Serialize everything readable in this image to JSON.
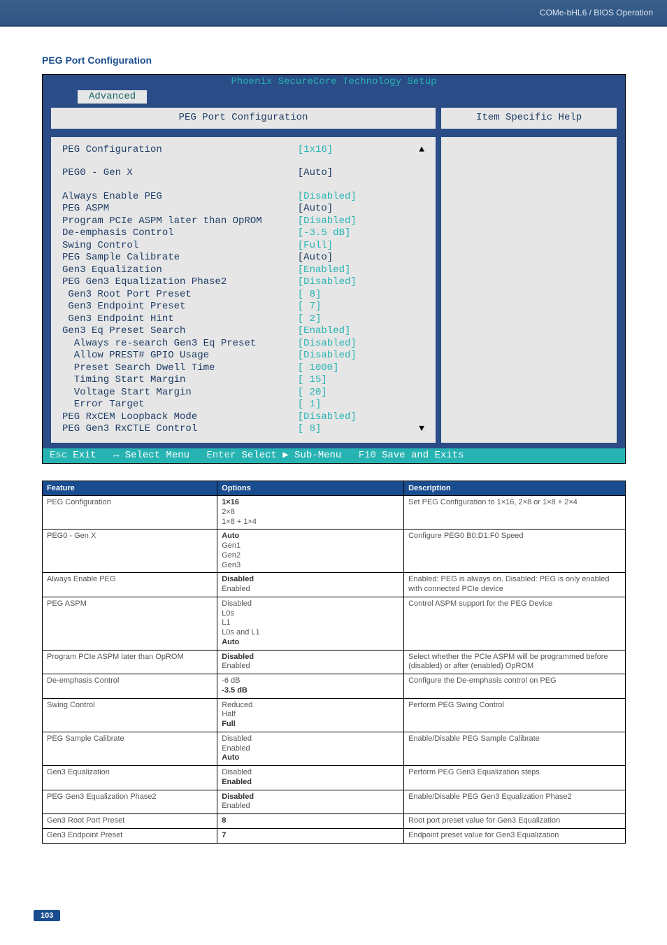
{
  "page_header": {
    "breadcrumb": "COMe-bHL6 / BIOS Operation"
  },
  "section_title": "PEG Port Configuration",
  "bios": {
    "title": "Phoenix SecureCore Technology Setup",
    "tab": "Advanced",
    "panel_heading": "PEG Port Configuration",
    "help_heading": "Item Specific Help",
    "items": [
      {
        "label": "PEG Configuration",
        "value": "[1x16]",
        "type": "edit",
        "blank_after": true,
        "arrow": "up"
      },
      {
        "label": "PEG0 - Gen X",
        "value": "[Auto]",
        "type": "link",
        "blank_after": true
      },
      {
        "label": "Always Enable PEG",
        "value": "[Disabled]",
        "type": "edit"
      },
      {
        "label": "PEG ASPM",
        "value": "[Auto]",
        "type": "link"
      },
      {
        "label": "Program PCIe ASPM later than OpROM",
        "value": "[Disabled]",
        "type": "edit"
      },
      {
        "label": "De-emphasis Control",
        "value": "[-3.5 dB]",
        "type": "edit"
      },
      {
        "label": "Swing Control",
        "value": "[Full]",
        "type": "edit"
      },
      {
        "label": "PEG Sample Calibrate",
        "value": "[Auto]",
        "type": "link"
      },
      {
        "label": "Gen3 Equalization",
        "value": "[Enabled]",
        "type": "edit"
      },
      {
        "label": "PEG Gen3 Equalization Phase2",
        "value": "[Disabled]",
        "type": "edit"
      },
      {
        "label": " Gen3 Root Port Preset",
        "value": "[ 8]",
        "type": "edit"
      },
      {
        "label": " Gen3 Endpoint Preset",
        "value": "[ 7]",
        "type": "edit"
      },
      {
        "label": " Gen3 Endpoint Hint",
        "value": "[ 2]",
        "type": "edit"
      },
      {
        "label": "Gen3 Eq Preset Search",
        "value": "[Enabled]",
        "type": "edit"
      },
      {
        "label": "  Always re-search Gen3 Eq Preset",
        "value": "[Disabled]",
        "type": "edit"
      },
      {
        "label": "  Allow PREST# GPIO Usage",
        "value": "[Disabled]",
        "type": "edit"
      },
      {
        "label": "  Preset Search Dwell Time",
        "value": "[ 1000]",
        "type": "edit"
      },
      {
        "label": "  Timing Start Margin",
        "value": "[ 15]",
        "type": "edit"
      },
      {
        "label": "  Voltage Start Margin",
        "value": "[ 20]",
        "type": "edit"
      },
      {
        "label": "  Error Target",
        "value": "[   1]",
        "type": "edit"
      },
      {
        "label": "PEG RxCEM Loopback Mode",
        "value": "[Disabled]",
        "type": "edit"
      },
      {
        "label": "PEG Gen3 RxCTLE Control",
        "value": "[ 8]",
        "type": "edit",
        "arrow": "down"
      }
    ],
    "footer": {
      "esc": "Esc",
      "exit": "Exit",
      "arrows": "↔",
      "select_menu": "Select Menu",
      "enter": "Enter",
      "select_sub": "Select ▶ Sub-Menu",
      "f10": "F10",
      "save": "Save and Exits"
    }
  },
  "table": {
    "headers": [
      "Feature",
      "Options",
      "Description"
    ],
    "rows": [
      {
        "feature": "PEG Configuration",
        "options": [
          {
            "t": "1×16",
            "b": true
          },
          {
            "t": "2×8"
          },
          {
            "t": "1×8 + 1×4"
          }
        ],
        "desc": "Set PEG Configuration to 1×16, 2×8 or 1×8 + 2×4"
      },
      {
        "feature": "PEG0 - Gen X",
        "options": [
          {
            "t": "Auto",
            "b": true
          },
          {
            "t": "Gen1"
          },
          {
            "t": "Gen2"
          },
          {
            "t": "Gen3"
          }
        ],
        "desc": "Configure PEG0 B0:D1:F0 Speed"
      },
      {
        "feature": "Always Enable PEG",
        "options": [
          {
            "t": "Disabled",
            "b": true
          },
          {
            "t": "Enabled"
          }
        ],
        "desc": "Enabled: PEG is always on. Disabled: PEG is only enabled with connected PCIe device"
      },
      {
        "feature": "PEG ASPM",
        "options": [
          {
            "t": "Disabled"
          },
          {
            "t": "L0s"
          },
          {
            "t": "L1"
          },
          {
            "t": "L0s and L1"
          },
          {
            "t": "Auto",
            "b": true
          }
        ],
        "desc": "Control ASPM support for the PEG Device"
      },
      {
        "feature": "Program PCIe ASPM later than OpROM",
        "options": [
          {
            "t": "Disabled",
            "b": true
          },
          {
            "t": "Enabled"
          }
        ],
        "desc": "Select whether the PCIe ASPM will be programmed before (disabled) or after (enabled) OpROM"
      },
      {
        "feature": "De-emphasis Control",
        "options": [
          {
            "t": "-6 dB"
          },
          {
            "t": "-3.5 dB",
            "b": true
          }
        ],
        "desc": "Configure the De-emphasis control on PEG"
      },
      {
        "feature": "Swing Control",
        "options": [
          {
            "t": "Reduced"
          },
          {
            "t": "Half"
          },
          {
            "t": "Full",
            "b": true
          }
        ],
        "desc": "Perform PEG Swing Control"
      },
      {
        "feature": "PEG Sample Calibrate",
        "options": [
          {
            "t": "Disabled"
          },
          {
            "t": "Enabled"
          },
          {
            "t": "Auto",
            "b": true
          }
        ],
        "desc": "Enable/Disable PEG Sample Calibrate"
      },
      {
        "feature": "Gen3 Equalization",
        "options": [
          {
            "t": "Disabled"
          },
          {
            "t": "Enabled",
            "b": true
          }
        ],
        "desc": "Perform PEG Gen3 Equalization steps"
      },
      {
        "feature": "PEG Gen3 Equalization Phase2",
        "options": [
          {
            "t": "Disabled",
            "b": true
          },
          {
            "t": "Enabled"
          }
        ],
        "desc": "Enable/Disable PEG Gen3 Equalization Phase2"
      },
      {
        "feature": "Gen3 Root Port Preset",
        "options": [
          {
            "t": "8",
            "b": true
          }
        ],
        "desc": "Root port preset value for Gen3 Equalization"
      },
      {
        "feature": "Gen3 Endpoint Preset",
        "options": [
          {
            "t": "7",
            "b": true
          }
        ],
        "desc": "Endpoint preset value for Gen3 Equalization"
      }
    ]
  },
  "page_number": "103"
}
